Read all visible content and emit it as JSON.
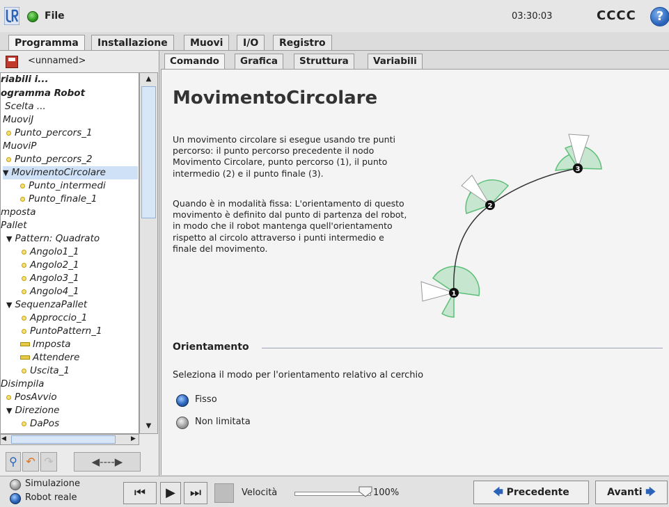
{
  "header": {
    "file_label": "File",
    "clock": "03:30:03",
    "robot_name": "CCCC",
    "help_glyph": "?"
  },
  "main_tabs": [
    "Programma",
    "Installazione",
    "Muovi",
    "I/O",
    "Registro"
  ],
  "left_panel": {
    "program_name": "<unnamed>",
    "tree": [
      {
        "label": "riabili i...",
        "bold": true
      },
      {
        "label": "ogramma Robot",
        "bold": true
      },
      {
        "label": "Scelta ..."
      },
      {
        "label": "MuoviJ"
      },
      {
        "label": "Punto_percors_1"
      },
      {
        "label": "MuoviP"
      },
      {
        "label": "Punto_percors_2"
      },
      {
        "label": "MovimentoCircolare",
        "selected": true
      },
      {
        "label": "Punto_intermedi"
      },
      {
        "label": "Punto_finale_1"
      },
      {
        "label": "mposta"
      },
      {
        "label": "Pallet"
      },
      {
        "label": "Pattern: Quadrato"
      },
      {
        "label": "Angolo1_1"
      },
      {
        "label": "Angolo2_1"
      },
      {
        "label": "Angolo3_1"
      },
      {
        "label": "Angolo4_1"
      },
      {
        "label": "SequenzaPallet"
      },
      {
        "label": "Approccio_1"
      },
      {
        "label": "PuntoPattern_1"
      },
      {
        "label": "Imposta"
      },
      {
        "label": "Attendere"
      },
      {
        "label": "Uscita_1"
      },
      {
        "label": "Disimpila"
      },
      {
        "label": "PosAvvio"
      },
      {
        "label": "Direzione"
      },
      {
        "label": "DaPos"
      }
    ],
    "tool_buttons": {
      "search": "search-icon",
      "undo": "undo-icon",
      "redo": "redo-icon",
      "move": "move-arrows-icon"
    }
  },
  "sub_tabs": [
    "Comando",
    "Grafica",
    "Struttura",
    "Variabili"
  ],
  "content": {
    "title": "MovimentoCircolare",
    "description_1": "Un movimento circolare si esegue usando tre punti percorso: il punto percorso precedente il nodo Movimento Circolare, punto percorso (1), il punto intermedio (2) e il punto finale (3).",
    "description_2": "Quando è in modalità fissa: L'orientamento di questo movimento è definito dal punto di partenza del robot, in modo che il robot mantenga quell'orientamento rispetto al circolo attraverso i punti intermedio e finale del movimento.",
    "diagram_points": [
      "1",
      "2",
      "3"
    ],
    "orientation_heading": "Orientamento",
    "orientation_prompt": "Seleziona il modo per l'orientamento relativo al cerchio",
    "options": [
      {
        "label": "Fisso",
        "selected": true
      },
      {
        "label": "Non limitata",
        "selected": false
      }
    ]
  },
  "footer": {
    "simulation_label": "Simulazione",
    "real_robot_label": "Robot reale",
    "real_robot_selected": true,
    "speed_label": "Velocità",
    "speed_value": "100%",
    "speed_fraction": 1.0,
    "prev_label": "Precedente",
    "next_label": "Avanti"
  },
  "colors": {
    "accent_blue": "#2a63b8",
    "status_green": "#2e9a1e",
    "diagram_sector": "#c6e6cf",
    "diagram_sector_edge": "#5cbf78"
  }
}
